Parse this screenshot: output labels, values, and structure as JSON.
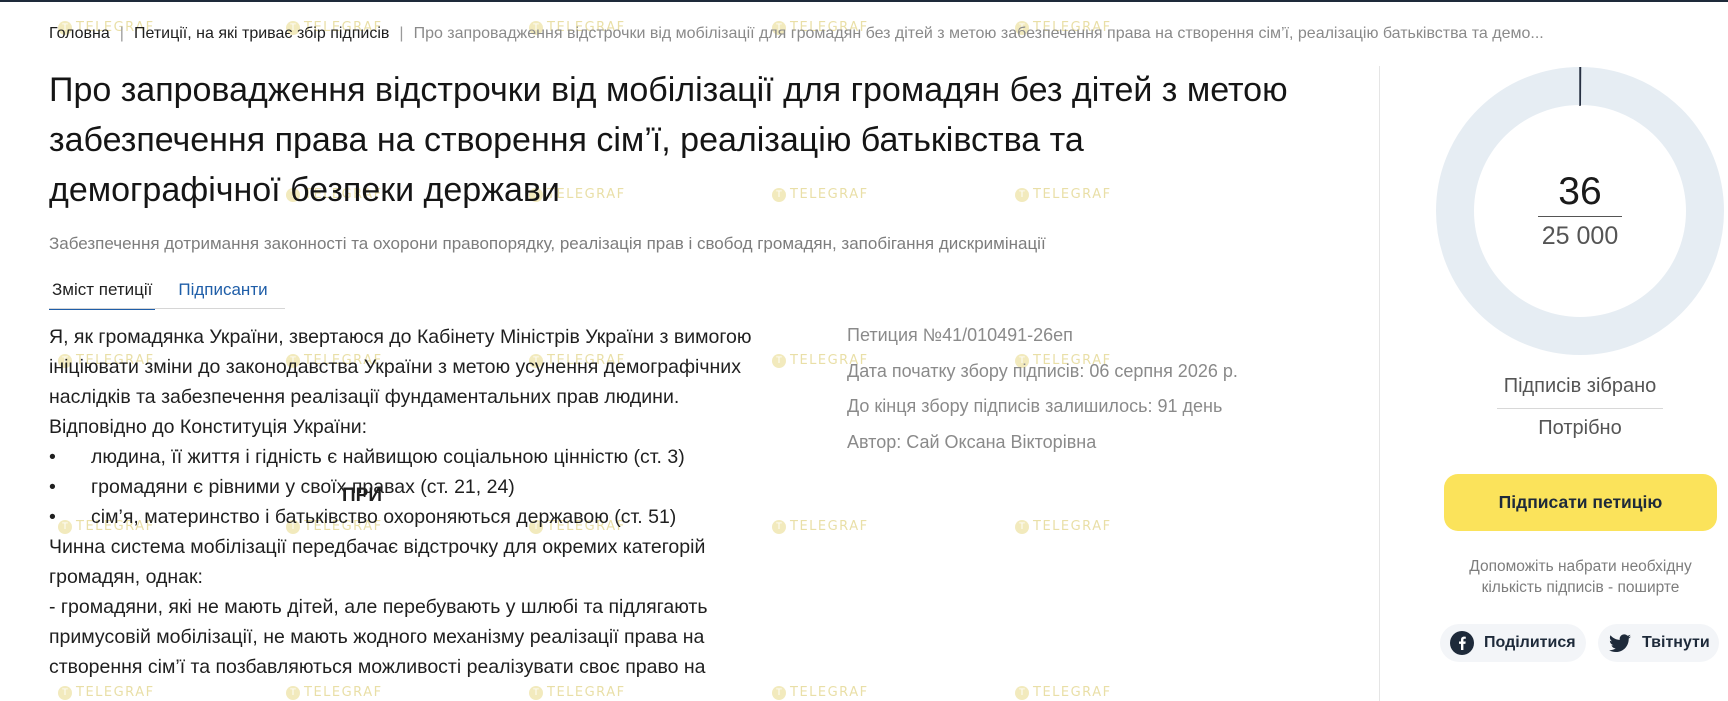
{
  "breadcrumb": {
    "home": "Головна",
    "section": "Петиції, на які триває збір підписів",
    "current": "Про запровадження відстрочки від мобілізації для громадян без дітей з метою забезпечення права на створення сім’ї, реалізацію батьківства та демо..."
  },
  "petition": {
    "title": "Про запровадження відстрочки від мобілізації для громадян без дітей з метою забезпечення права на створення сім’ї, реалізацію батьківства та демографічної безпеки держави",
    "category": "Забезпечення дотримання законності та охорони правопорядку, реалізація прав і свобод громадян, запобігання дискримінації"
  },
  "tabs": {
    "content": "Зміст петиції",
    "signers": "Підписанти"
  },
  "body": {
    "p1": "Я, як громадянка України, звертаюся до Кабінету Міністрів України з вимогою ініціювати зміни до законодавства України з метою усунення демографічних наслідків та забезпечення реалізації фундаментальних прав людини.",
    "p2": "Відповідно до Конституція України:",
    "bullet_symbol": "•",
    "b1": "людина, її життя і гідність є найвищою соціальною цінністю (ст. 3)",
    "b2": "громадяни є рівними у своїх правах (ст. 21, 24)",
    "b3": "сім’я, материнство і батьківство охороняються державою (ст. 51)",
    "p3": "Чинна система мобілізації передбачає відстрочку для окремих категорій громадян, однак:",
    "p4": "- громадяни, які не мають дітей, але перебувають у шлюбі та підлягають примусовій мобілізації, не мають жодного механізму реалізації права на створення сім’ї та позбавляються можливості реалізувати своє право на",
    "stray": "ПРИ"
  },
  "meta": {
    "number": "Петиция №41/010491-26еп",
    "start_date": "Дата початку збору підписів: 06 серпня 2026 р.",
    "remaining": "До кінця збору підписів залишилось: 91 день",
    "author": "Автор: Сай Оксана Вікторівна"
  },
  "signatures": {
    "count": "36",
    "target": "25 000",
    "progress_fraction": 0.00144,
    "collected_label": "Підписів зібрано",
    "needed_label": "Потрібно"
  },
  "actions": {
    "sign": "Підписати петицію",
    "share_note": "Допоможіть набрати необхідну кількість підписів - поширте",
    "facebook": "Поділитися",
    "twitter": "Твітнути"
  },
  "watermark": "TELEGRAF",
  "colors": {
    "accent_blue": "#1f5ea8",
    "sign_button": "#fbe35b",
    "ring": "#e6edf3",
    "navy": "#1e2a3a"
  },
  "icons": [
    "facebook-icon",
    "twitter-icon",
    "telegraf-watermark-icon"
  ]
}
